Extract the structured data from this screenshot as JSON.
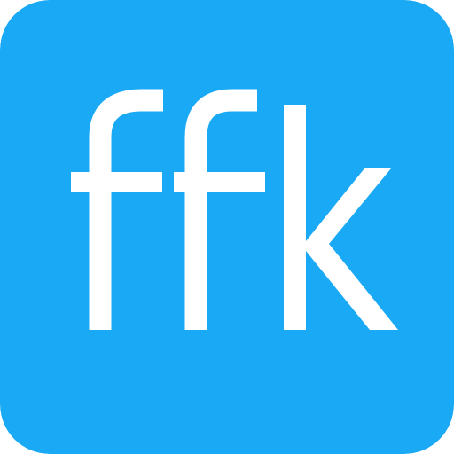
{
  "icon": {
    "logo_text": "ffk",
    "background_color": "#1aa9f5",
    "foreground_color": "#ffffff"
  }
}
